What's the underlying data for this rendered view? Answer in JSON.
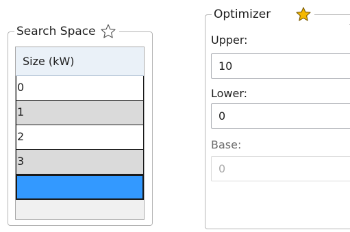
{
  "search_space": {
    "title": "Search Space",
    "star_icon": "star-outline-icon",
    "column_header": "Size (kW)",
    "rows": [
      "0",
      "1",
      "2",
      "3"
    ],
    "new_row_color": "#3399ff"
  },
  "optimizer": {
    "title": "Optimizer",
    "star_icon": "star-filled-icon",
    "star_color": "#f5b800",
    "upper_label": "Upper:",
    "upper_value": "10",
    "lower_label": "Lower:",
    "lower_value": "0",
    "base_label": "Base:",
    "base_value": "0"
  }
}
